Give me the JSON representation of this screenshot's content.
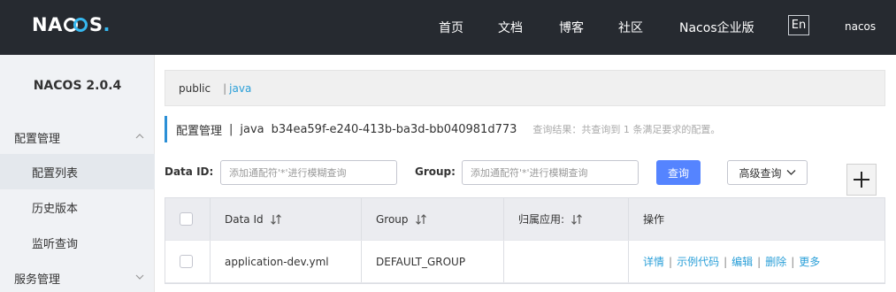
{
  "header": {
    "logo_left": "NA",
    "logo_right": "S",
    "logo_dot": ".",
    "nav": [
      "首页",
      "文档",
      "博客",
      "社区",
      "Nacos企业版"
    ],
    "lang": "En",
    "user": "nacos"
  },
  "sidebar": {
    "version": "NACOS 2.0.4",
    "items": [
      {
        "label": "配置管理",
        "type": "group"
      },
      {
        "label": "配置列表",
        "type": "sub",
        "active": true
      },
      {
        "label": "历史版本",
        "type": "sub"
      },
      {
        "label": "监听查询",
        "type": "sub"
      },
      {
        "label": "服务管理",
        "type": "group"
      }
    ]
  },
  "breadcrumb": {
    "public": "public",
    "sep": "|",
    "namespace": "java"
  },
  "title": {
    "main": "配置管理",
    "sep": "|",
    "ns": "java",
    "ns_id": "b34ea59f-e240-413b-ba3d-bb040981d773",
    "hint": "查询结果：共查询到 1 条满足要求的配置。"
  },
  "filters": {
    "dataid_label": "Data ID:",
    "dataid_placeholder": "添加通配符'*'进行模糊查询",
    "group_label": "Group:",
    "group_placeholder": "添加通配符'*'进行模糊查询",
    "query_button": "查询",
    "advanced_button": "高级查询"
  },
  "table": {
    "headers": [
      "Data Id",
      "Group",
      "归属应用:",
      "操作"
    ],
    "rows": [
      {
        "dataid": "application-dev.yml",
        "group": "DEFAULT_GROUP",
        "app": "",
        "ops": [
          "详情",
          "示例代码",
          "编辑",
          "删除",
          "更多"
        ]
      }
    ]
  },
  "colors": {
    "topbar": "#262a30",
    "accent": "#5584ff",
    "link": "#2a9fd8"
  }
}
